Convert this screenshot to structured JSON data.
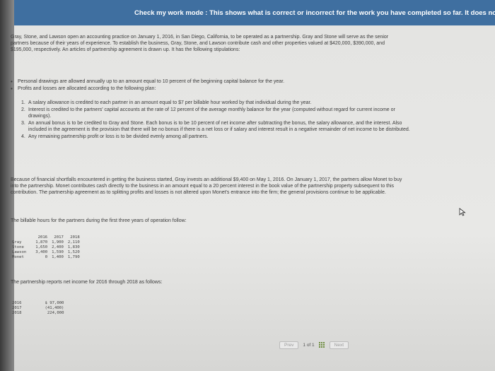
{
  "banner": {
    "text": "Check my work mode : This shows what is correct or incorrect for the work you have completed so far. It does not indi"
  },
  "intro": "Gray, Stone, and Lawson open an accounting practice on January 1, 2016, in San Diego, California, to be operated as a partnership. Gray and Stone will serve as the senior partners because of their years of experience. To establish the business, Gray, Stone, and Lawson contribute cash and other properties valued at $420,000, $390,000, and $195,000, respectively. An articles of partnership agreement is drawn up. It has the following stipulations:",
  "bullets": [
    "Personal drawings are allowed annually up to an amount equal to 10 percent of the beginning capital balance for the year.",
    "Profits and losses are allocated according to the following plan:"
  ],
  "steps": [
    {
      "num": "1.",
      "text": "A salary allowance is credited to each partner in an amount equal to $7 per billable hour worked by that individual during the year."
    },
    {
      "num": "2.",
      "text": "Interest is credited to the partners' capital accounts at the rate of 12 percent of the average monthly balance for the year (computed without regard for current income or drawings)."
    },
    {
      "num": "3.",
      "text": "An annual bonus is to be credited to Gray and Stone. Each bonus is to be 10 percent of net income after subtracting the bonus, the salary allowance, and the interest. Also included in the agreement is the provision that there will be no bonus if there is a net loss or if salary and interest result in a negative remainder of net income to be distributed."
    },
    {
      "num": "4.",
      "text": "Any remaining partnership profit or loss is to be divided evenly among all partners."
    }
  ],
  "para2": "Because of financial shortfalls encountered in getting the business started, Gray invests an additional $9,400 on May 1, 2016. On January 1, 2017, the partners allow Monet to buy into the partnership. Monet contributes cash directly to the business in an amount equal to a 20 percent interest in the book value of the partnership property subsequent to this contribution. The partnership agreement as to splitting profits and losses is not altered upon Monet's entrance into the firm; the general provisions continue to be applicable.",
  "hours_intro": "The billable hours for the partners during the first three years of operation follow:",
  "hours_table": {
    "headers": [
      "2016",
      "2017",
      "2018"
    ],
    "rows": [
      {
        "name": "Gray",
        "values": [
          "1,870",
          "1,900",
          "2,110"
        ]
      },
      {
        "name": "Stone",
        "values": [
          "1,650",
          "2,400",
          "1,830"
        ]
      },
      {
        "name": "Lawson",
        "values": [
          "3,400",
          "1,590",
          "1,520"
        ]
      },
      {
        "name": "Monet",
        "values": [
          "0",
          "1,400",
          "1,790"
        ]
      }
    ]
  },
  "net_intro": "The partnership reports net income for 2016 through 2018 as follows:",
  "net_table": {
    "rows": [
      {
        "year": "2016",
        "value": "$ 97,000"
      },
      {
        "year": "2017",
        "value": "(41,400)"
      },
      {
        "year": "2018",
        "value": "224,000"
      }
    ]
  },
  "footer": {
    "prev_label": "Prev",
    "page_current": "1",
    "page_of": "of",
    "page_total": "1",
    "next_label": "Next"
  },
  "colors": {
    "banner": "#3f6fa0",
    "grid_icon": "#6a8a3a"
  }
}
